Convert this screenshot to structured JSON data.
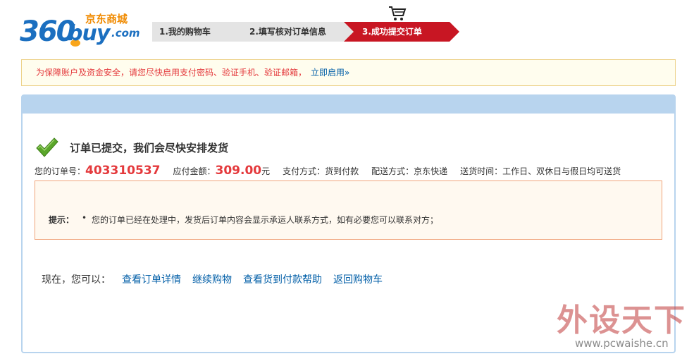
{
  "header": {
    "logo_number": "360",
    "logo_buy": "buy",
    "logo_com": ".com",
    "logo_cn": "京东商城",
    "steps": [
      {
        "label": "1.我的购物车"
      },
      {
        "label": "2.填写核对订单信息"
      },
      {
        "label": "3.成功提交订单"
      }
    ],
    "icon": "shopping-cart-icon"
  },
  "notice": {
    "text": "为保障账户及资金安全，请您尽快启用支付密码、验证手机、验证邮箱，",
    "link": "立即启用»"
  },
  "order": {
    "title": "订单已提交，我们会尽快安排发货",
    "order_no_label": "您的订单号：",
    "order_no": "403310537",
    "amount_label": "应付金额：",
    "amount": "309.00",
    "amount_unit": "元",
    "payment": "支付方式：货到付款",
    "shipping": "配送方式：京东快递",
    "delivery_time": "送货时间：工作日、双休日与假日均可送货"
  },
  "tip": {
    "label": "提示：",
    "bullet": "•",
    "text": "您的订单已经在处理中，发货后订单内容会显示承运人联系方式，如有必要您可以联系对方；"
  },
  "actions": {
    "prefix": "现在，您可以：",
    "links": [
      "查看订单详情",
      "继续购物",
      "查看货到付款帮助",
      "返回购物车"
    ]
  },
  "watermark": {
    "cn": "外设天下",
    "url": "www.pcwaishe.cn"
  },
  "colors": {
    "brand_blue": "#1b6fc0",
    "active_step": "#c81623",
    "price_red": "#e4393c",
    "link_blue": "#005ea7"
  }
}
